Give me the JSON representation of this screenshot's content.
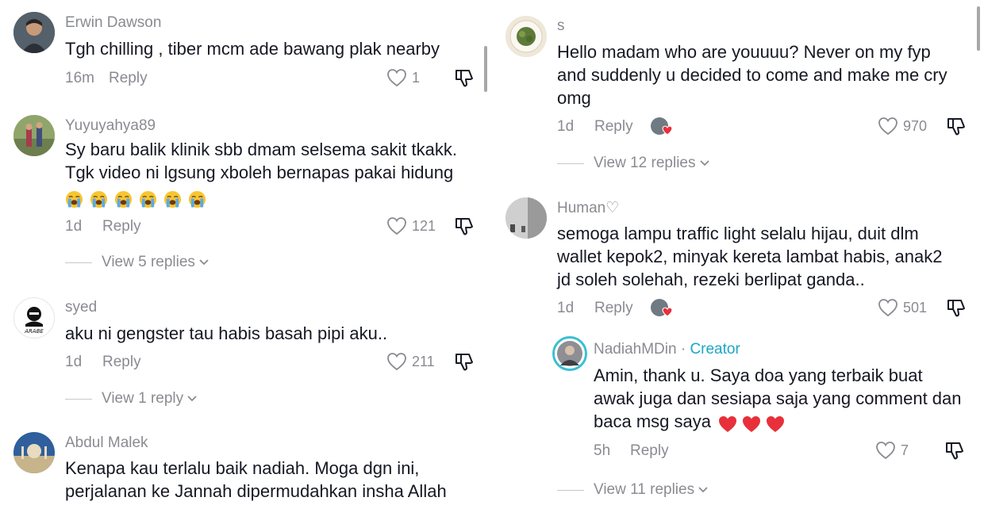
{
  "left_comments": [
    {
      "username": "Erwin Dawson",
      "text": "Tgh chilling , tiber mcm ade bawang plak nearby",
      "time": "16m",
      "reply_label": "Reply",
      "likes": "1"
    },
    {
      "username": "Yuyuyahya89",
      "text_lines": [
        "Sy baru balik klinik sbb dmam selsema sakit tkakk.",
        "Tgk video ni lgsung xboleh bernapas pakai hidung"
      ],
      "emoji_count": 6,
      "time": "1d",
      "reply_label": "Reply",
      "likes": "121",
      "view_replies": "View 5 replies"
    },
    {
      "username": "syed",
      "text": "aku ni gengster tau habis basah pipi aku..",
      "time": "1d",
      "reply_label": "Reply",
      "likes": "211",
      "view_replies": "View 1 reply"
    },
    {
      "username": "Abdul Malek",
      "text_lines": [
        "Kenapa kau terlalu baik nadiah. Moga dgn ini,",
        "perjalanan ke Jannah dipermudahkan insha Allah"
      ]
    }
  ],
  "right_comments": [
    {
      "username": "s",
      "text_lines": [
        "Hello madam who are youuuu? Never on my fyp",
        "and suddenly u decided to come and make me cry",
        "omg"
      ],
      "time": "1d",
      "reply_label": "Reply",
      "likes": "970",
      "view_replies": "View 12 replies"
    },
    {
      "username": "Human♡",
      "text_lines": [
        "semoga lampu traffic light selalu hijau, duit dlm",
        "wallet kepok2, minyak kereta lambat habis, anak2",
        "jd soleh solehah, rezeki berlipat ganda.."
      ],
      "time": "1d",
      "reply_label": "Reply",
      "likes": "501"
    },
    {
      "username": "NadiahMDin",
      "creator_sep": " · ",
      "creator_label": "Creator",
      "text_lines": [
        "Amin, thank u. Saya doa yang terbaik buat",
        "awak juga dan sesiapa saja yang comment dan",
        "baca msg saya"
      ],
      "time": "5h",
      "reply_label": "Reply",
      "likes": "7",
      "view_replies": "View 11 replies"
    }
  ],
  "colors": {
    "text": "#161823",
    "muted": "#8a8b91",
    "creator": "#1ba6c7",
    "heart": "#e8303a"
  },
  "icons": [
    "heart-outline-icon",
    "dislike-icon",
    "chevron-down-icon",
    "crying-emoji-icon",
    "red-heart-emoji-icon"
  ]
}
